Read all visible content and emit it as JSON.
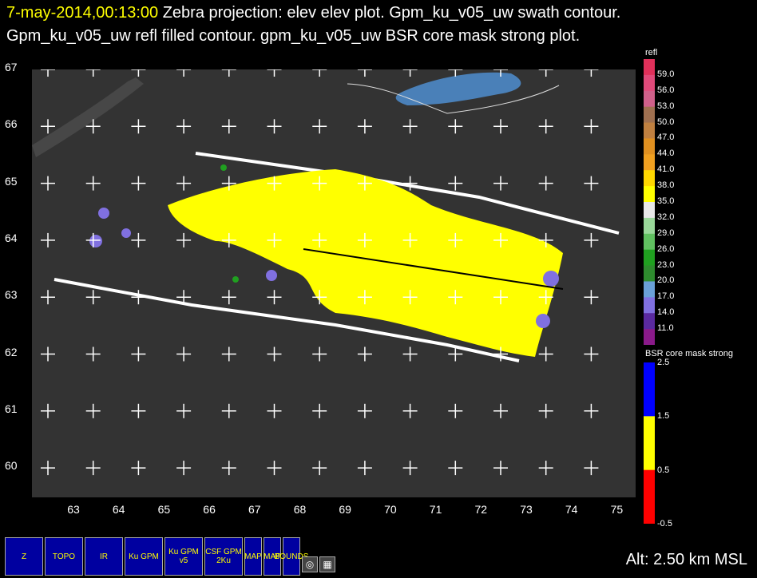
{
  "title": {
    "timestamp": "7-may-2014,00:13:00",
    "text": "Zebra projection: elev elev  plot.  Gpm_ku_v05_uw swath contour.  Gpm_ku_v05_uw refl filled contour.  gpm_ku_v05_uw BSR core mask strong  plot."
  },
  "y_axis": [
    "67",
    "66",
    "65",
    "64",
    "63",
    "62",
    "61",
    "60"
  ],
  "x_axis": [
    "63",
    "64",
    "65",
    "66",
    "67",
    "68",
    "69",
    "70",
    "71",
    "72",
    "73",
    "74",
    "75"
  ],
  "refl_legend": {
    "title": "refl",
    "ticks": [
      "59.0",
      "56.0",
      "53.0",
      "50.0",
      "47.0",
      "44.0",
      "41.0",
      "38.0",
      "35.0",
      "32.0",
      "29.0",
      "26.0",
      "23.0",
      "20.0",
      "17.0",
      "14.0",
      "11.0"
    ],
    "colors": [
      "#e0305a",
      "#e04a7a",
      "#d0608a",
      "#a07050",
      "#c08040",
      "#e09020",
      "#f0a020",
      "#ffd700",
      "#ffff00",
      "#e8e8e8",
      "#9ad89a",
      "#60c060",
      "#20a020",
      "#2e8b2e",
      "#6aa0d8",
      "#8070e0",
      "#5a2aa0",
      "#8a1a8a"
    ]
  },
  "bsr_legend": {
    "title": "BSR core mask strong",
    "ticks": [
      "2.5",
      "1.5",
      "0.5",
      "-0.5"
    ],
    "colors": [
      "#0000ff",
      "#ffff00",
      "#ff0000"
    ]
  },
  "toolbar": {
    "buttons": [
      {
        "label": "Z",
        "icon": "zebra-logo-icon"
      },
      {
        "label": "TOPO",
        "icon": "topo-icon"
      },
      {
        "label": "IR",
        "icon": "ir-icon"
      },
      {
        "label": "Ku GPM",
        "icon": "ku-gpm-icon"
      },
      {
        "label": "Ku GPM v5",
        "icon": "ku-gpm-v5-icon"
      },
      {
        "label": "CSF GPM 2Ku",
        "icon": "csf-gpm-icon"
      },
      {
        "label": "MAP",
        "icon": "map-icon"
      },
      {
        "label": "MAP",
        "icon": "map2-icon"
      },
      {
        "label": "BOUNDS",
        "icon": "bounds-icon"
      }
    ],
    "small": [
      {
        "label": "◎",
        "icon": "target-icon"
      },
      {
        "label": "▦",
        "icon": "grid-icon"
      }
    ]
  },
  "altitude": "Alt: 2.50 km MSL"
}
